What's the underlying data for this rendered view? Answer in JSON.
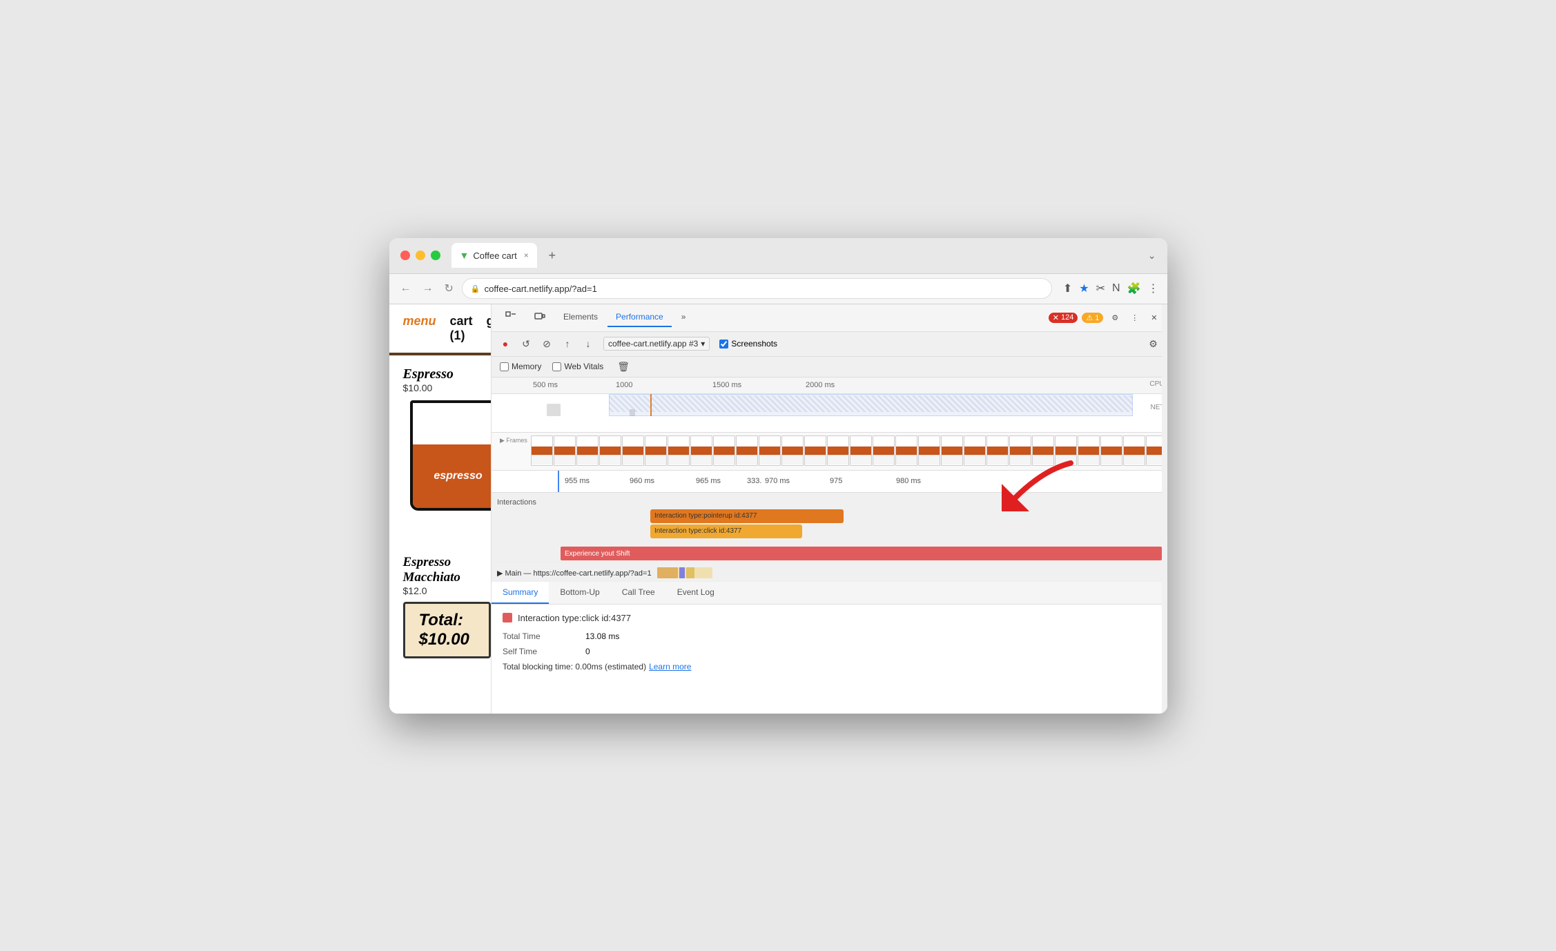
{
  "browser": {
    "traffic_lights": [
      "red",
      "yellow",
      "green"
    ],
    "tab": {
      "favicon": "▼",
      "title": "Coffee cart",
      "close": "×"
    },
    "new_tab": "+",
    "tab_menu": "⌄",
    "address": "coffee-cart.netlify.app/?ad=1",
    "nav": {
      "back": "←",
      "forward": "→",
      "refresh": "↻"
    },
    "toolbar_icons": [
      "↑□",
      "★",
      "✂",
      "n",
      "□□",
      "🧩",
      "▲",
      "⬜",
      "👤",
      "⋮"
    ]
  },
  "website": {
    "nav": {
      "menu": "menu",
      "cart": "cart (1)",
      "github": "github"
    },
    "item1": {
      "name": "Espresso",
      "price": "$10.00",
      "cup_text": "espresso"
    },
    "item2": {
      "name": "Espresso Macchiato",
      "price": "$12.0"
    },
    "total": "Total: $10.00"
  },
  "devtools": {
    "tabs": [
      "Elements",
      "Performance",
      "»"
    ],
    "active_tab": "Performance",
    "error_count": "124",
    "warn_count": "1",
    "icons": [
      "⚙",
      "⋮",
      "×"
    ],
    "toolbar": {
      "record": "●",
      "reload": "↺",
      "clear": "⊘",
      "upload": "↑",
      "download": "↓",
      "session": "coffee-cart.netlify.app #3",
      "screenshots_label": "Screenshots",
      "settings": "⚙"
    },
    "checkboxes": {
      "memory": "Memory",
      "web_vitals": "Web Vitals"
    },
    "timeline": {
      "markers": [
        "500 ms",
        "1000",
        "1500 ms",
        "2000 ms"
      ],
      "cpu_label": "CPU",
      "net_label": "NET"
    },
    "zoom_markers": [
      "955 ms",
      "960 ms",
      "965 ms",
      "970 ms",
      "975",
      "980 ms"
    ],
    "interactions_label": "Interactions",
    "interaction_pointerup": "Interaction type:pointerup id:4377",
    "interaction_click": "Interaction type:click id:4377",
    "experience_text": "Experience yout Shift",
    "main_thread_label": "▶ Main — https://coffee-cart.netlify.app/?ad=1",
    "bottom_tabs": [
      "Summary",
      "Bottom-Up",
      "Call Tree",
      "Event Log"
    ],
    "active_bottom_tab": "Summary",
    "summary": {
      "title": "Interaction type:click id:4377",
      "total_time_label": "Total Time",
      "total_time_value": "13.08 ms",
      "self_time_label": "Self Time",
      "self_time_value": "0",
      "blocking_label": "Total blocking time: 0.00ms (estimated)",
      "learn_more": "Learn more"
    }
  }
}
